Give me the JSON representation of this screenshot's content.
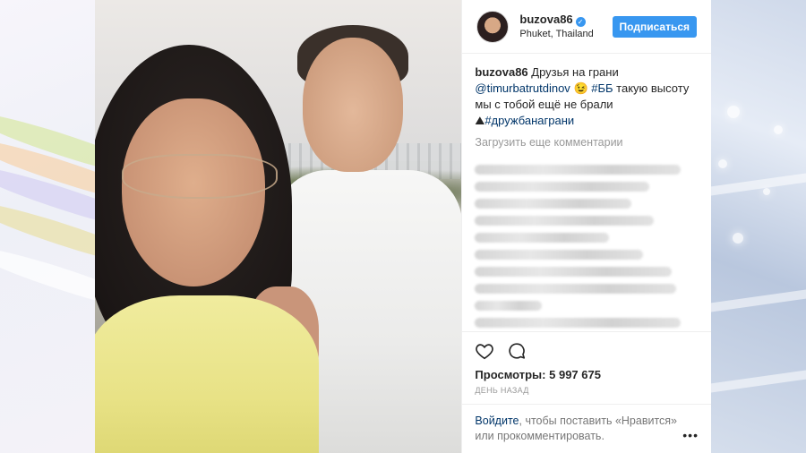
{
  "header": {
    "username": "buzova86",
    "location": "Phuket, Thailand",
    "follow_label": "Подписаться"
  },
  "caption": {
    "username": "buzova86",
    "text_1": "Друзья на грани",
    "mention": "@timurbatrutdinov",
    "emoji": "😉",
    "hashtag_1": "#ББ",
    "text_2": "такую высоту мы с тобой ещё не брали",
    "emoji_2": "⛰",
    "hashtag_2": "#дружбанаграни"
  },
  "comments": {
    "load_more": "Загрузить еще комментарии"
  },
  "stats": {
    "views_label": "Просмотры:",
    "views_value": "5 997 675",
    "time": "ДЕНЬ НАЗАД"
  },
  "login": {
    "link": "Войдите",
    "text": ", чтобы поставить «Нравится» или прокомментировать.",
    "more": "•••"
  },
  "colors": {
    "accent": "#3897f0",
    "link": "#003569"
  }
}
